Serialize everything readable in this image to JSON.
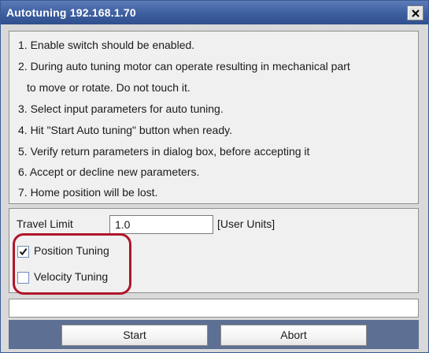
{
  "window": {
    "title": "Autotuning 192.168.1.70",
    "close_icon": "close-icon"
  },
  "instructions": [
    "1. Enable switch should be enabled.",
    "2. During auto tuning motor can operate resulting in mechanical part",
    "to move or rotate. Do not touch it.",
    "3. Select input parameters for auto tuning.",
    "4. Hit \"Start Auto tuning\" button when ready.",
    "5. Verify return parameters in dialog box, before accepting it",
    "6. Accept or decline new parameters.",
    "7. Home position will be lost."
  ],
  "params": {
    "travel_limit_label": "Travel Limit",
    "travel_limit_value": "1.0",
    "units_label": "[User Units]",
    "position_tuning": {
      "label": "Position Tuning",
      "checked": true
    },
    "velocity_tuning": {
      "label": "Velocity Tuning",
      "checked": false
    }
  },
  "status": {
    "text": ""
  },
  "buttons": {
    "start": "Start",
    "abort": "Abort"
  },
  "colors": {
    "title_bar": "#3d5f9f",
    "button_bar": "#5d6f92",
    "highlight": "#b0152a"
  }
}
